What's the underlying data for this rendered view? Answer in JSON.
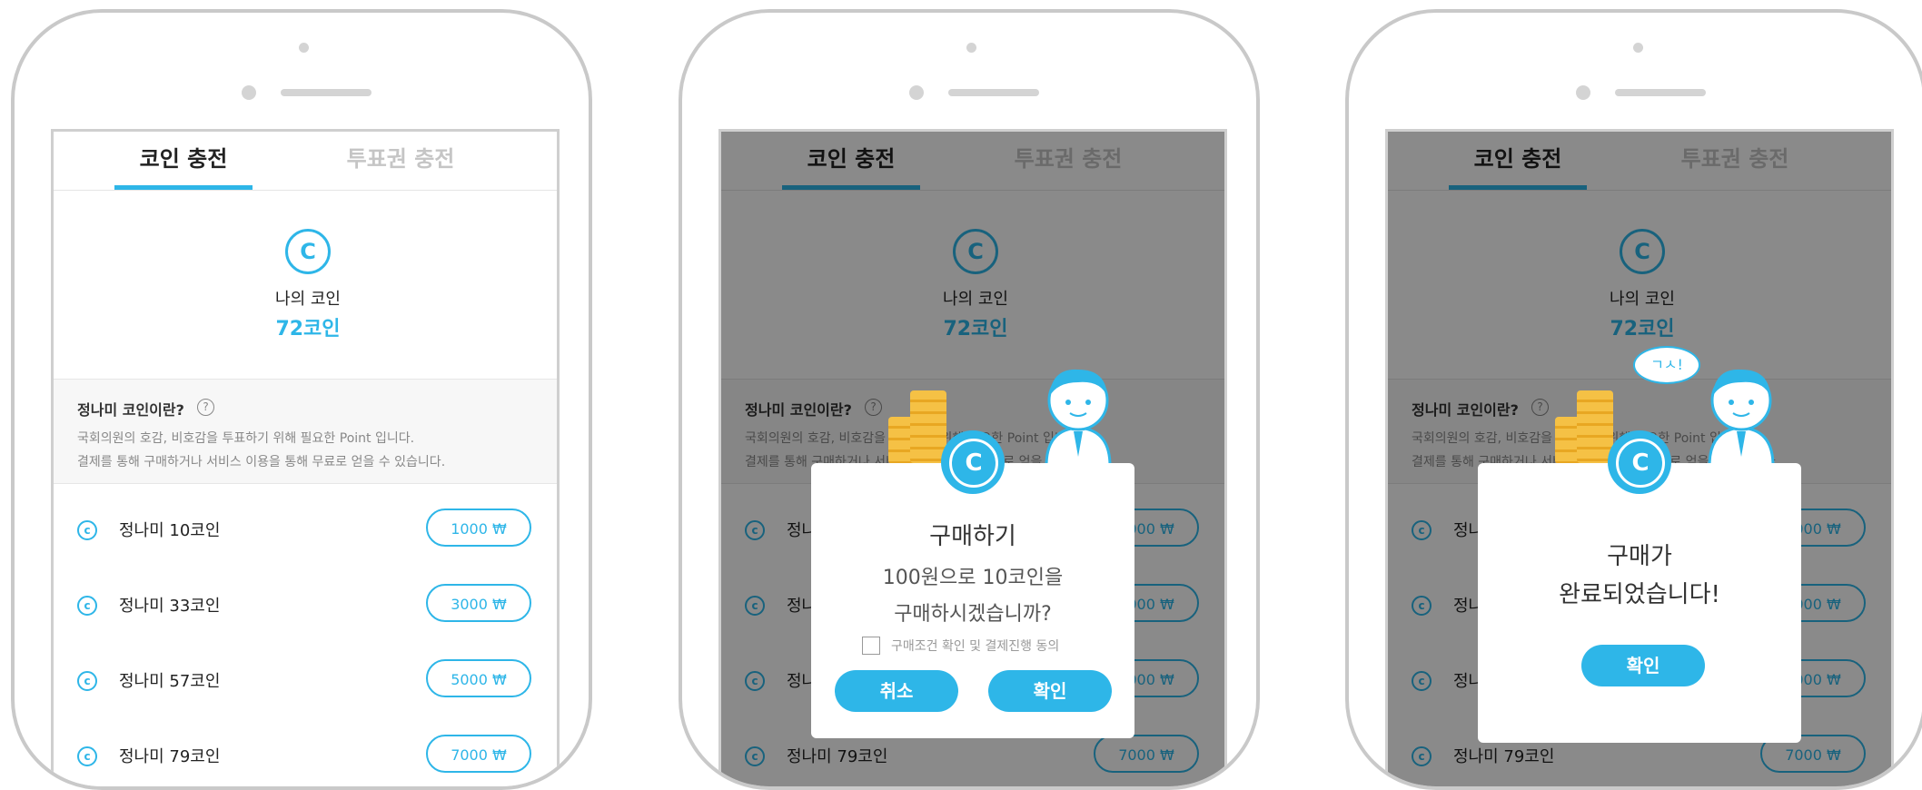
{
  "tabs": {
    "coin": "코인 충전",
    "vote": "투표권 충전"
  },
  "coin_symbol": "C",
  "my_coin": {
    "label": "나의 코인",
    "value": "72코인"
  },
  "info": {
    "title": "정나미 코인이란?",
    "help_glyph": "?",
    "line1": "국회의원의 호감, 비호감을 투표하기 위해 필요한 Point 입니다.",
    "line2": "결제를 통해 구매하거나 서비스 이용을 통해 무료로 얻을 수 있습니다."
  },
  "products": [
    {
      "icon": "c",
      "name": "정나미 10코인",
      "price": "1000 ₩"
    },
    {
      "icon": "c",
      "name": "정나미 33코인",
      "price": "3000 ₩"
    },
    {
      "icon": "c",
      "name": "정나미 57코인",
      "price": "5000 ₩"
    },
    {
      "icon": "c",
      "name": "정나미 79코인",
      "price": "7000 ₩"
    }
  ],
  "purchase_dialog": {
    "title": "구매하기",
    "line1": "100원으로 10코인을",
    "line2": "구매하시겠습니까?",
    "agree_label": "구매조건 확인 및 결제진행 동의",
    "cancel": "취소",
    "confirm": "확인"
  },
  "complete_dialog": {
    "line1": "구매가",
    "line2": "완료되었습니다!",
    "confirm": "확인"
  },
  "mascot_speech": "ㄱㅅ!",
  "colors": {
    "accent": "#2eb6e8",
    "overlay": "rgba(0,0,0,0.46)",
    "frame": "#c9c9c9"
  },
  "icons": [
    "coin-icon",
    "help-icon",
    "checkbox-icon",
    "mascot-icon",
    "coin-stack-icon"
  ]
}
